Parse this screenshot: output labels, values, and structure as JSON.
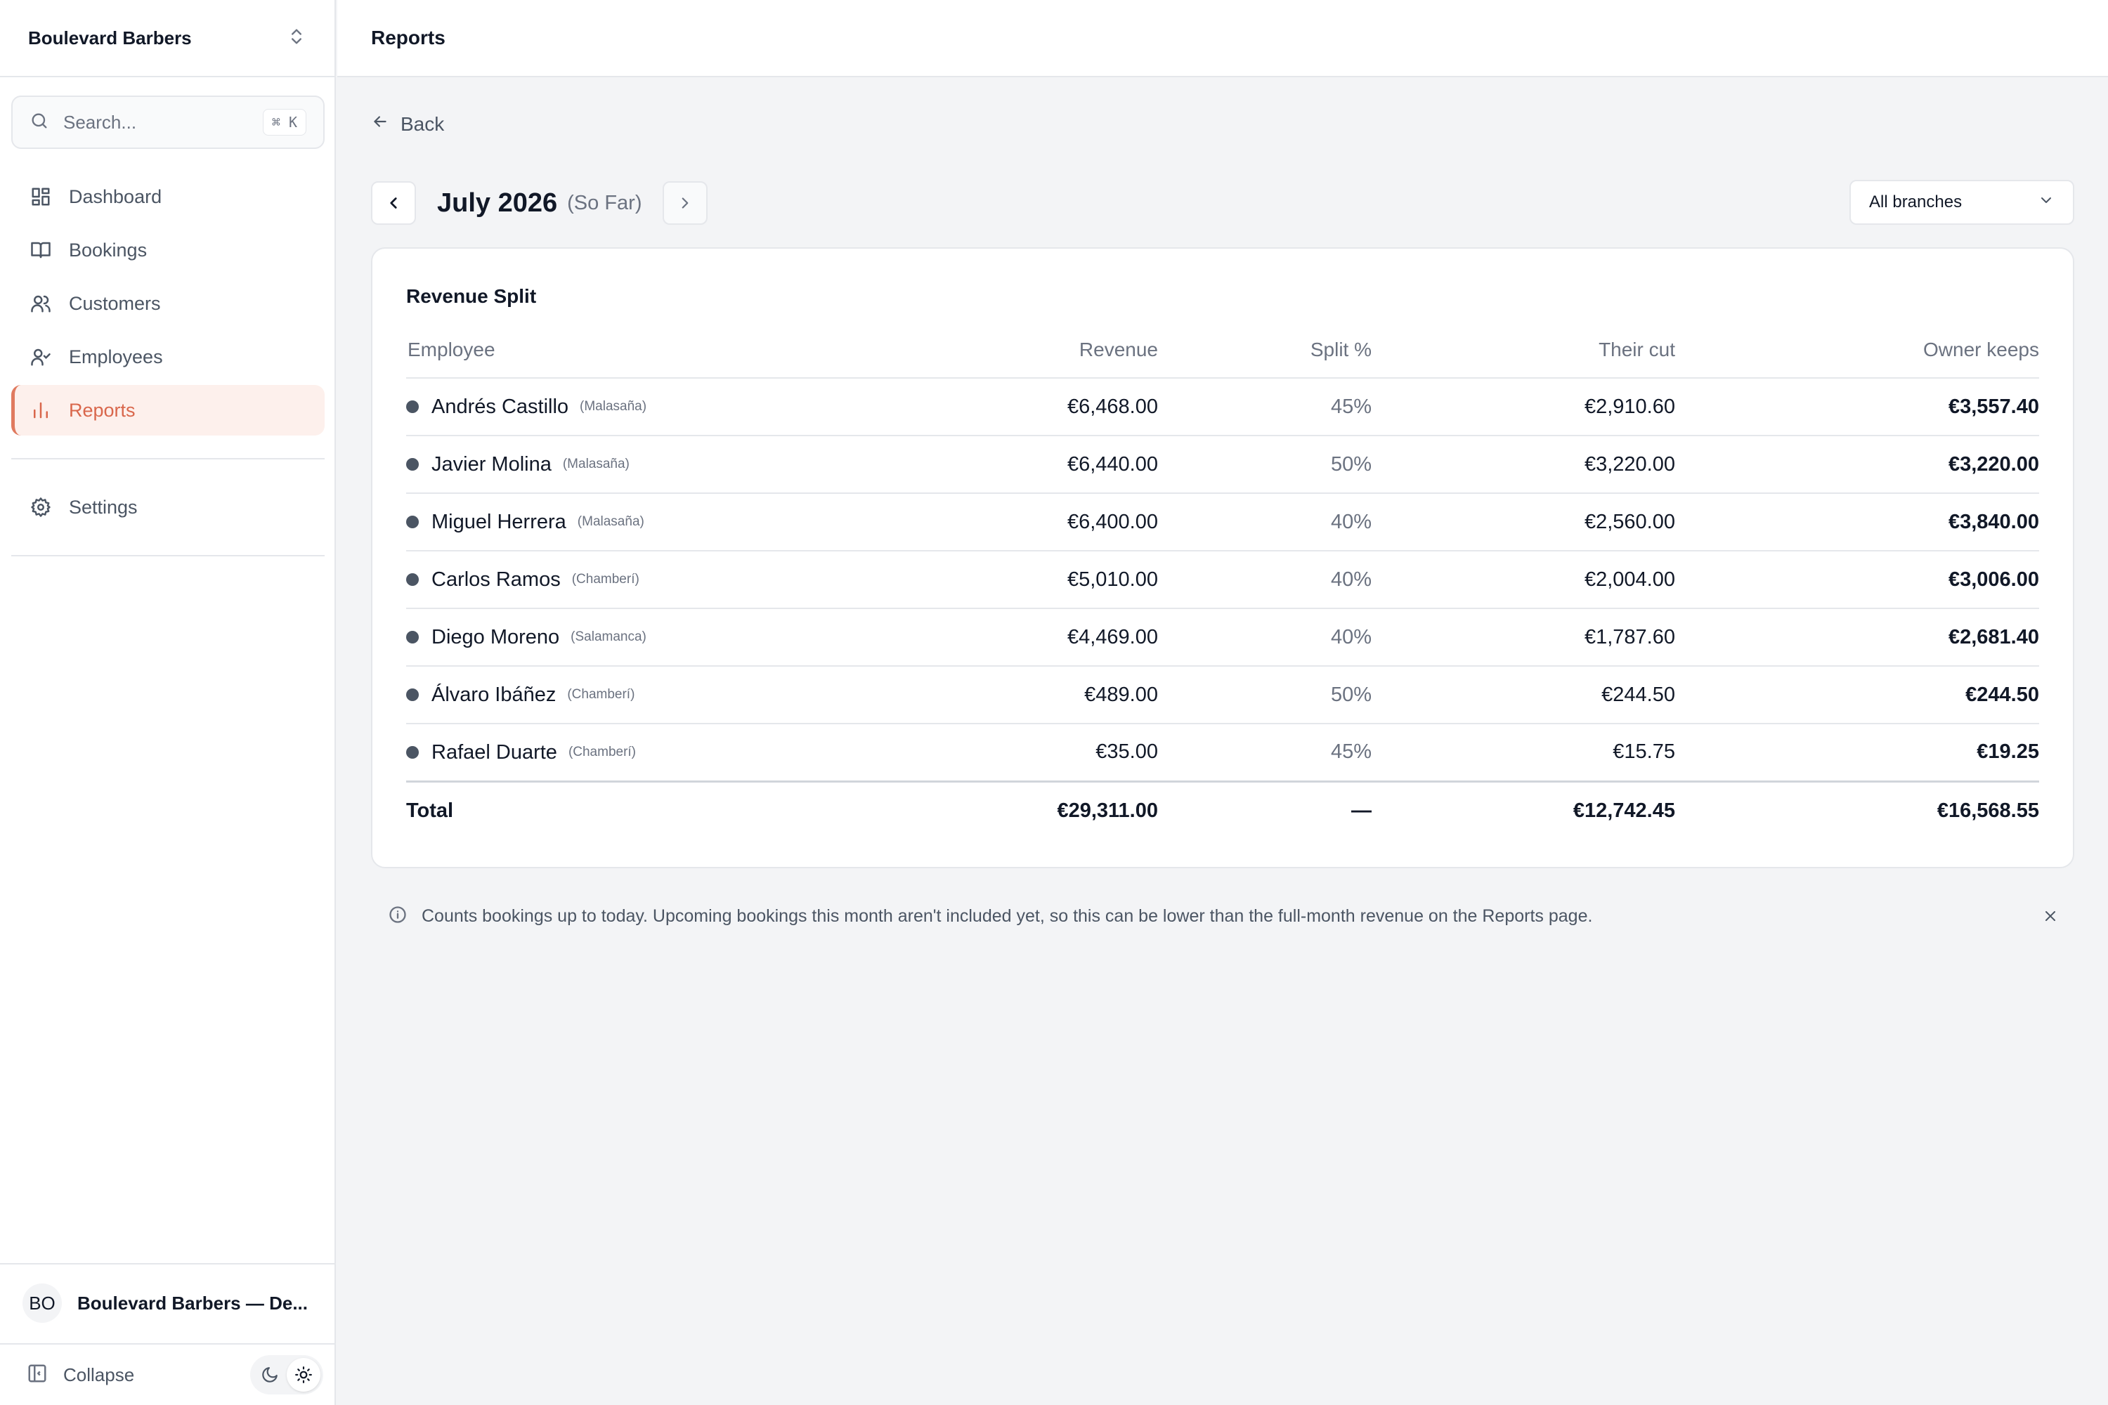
{
  "org": {
    "name": "Boulevard Barbers"
  },
  "search": {
    "placeholder": "Search...",
    "shortcut": "⌘ K"
  },
  "nav": {
    "items": [
      {
        "label": "Dashboard"
      },
      {
        "label": "Bookings"
      },
      {
        "label": "Customers"
      },
      {
        "label": "Employees"
      },
      {
        "label": "Reports"
      }
    ],
    "settings": "Settings"
  },
  "user": {
    "initials": "BO",
    "name": "Boulevard Barbers — De..."
  },
  "footer": {
    "collapse": "Collapse"
  },
  "header": {
    "title": "Reports"
  },
  "main": {
    "back": "Back",
    "month": "July 2026",
    "month_note": "(So Far)",
    "branch_filter": "All branches"
  },
  "report": {
    "title": "Revenue Split",
    "columns": {
      "employee": "Employee",
      "revenue": "Revenue",
      "split": "Split %",
      "cut": "Their cut",
      "keeps": "Owner keeps"
    },
    "rows": [
      {
        "name": "Andrés Castillo",
        "branch": "(Malasaña)",
        "revenue": "€6,468.00",
        "split": "45%",
        "cut": "€2,910.60",
        "keeps": "€3,557.40"
      },
      {
        "name": "Javier Molina",
        "branch": "(Malasaña)",
        "revenue": "€6,440.00",
        "split": "50%",
        "cut": "€3,220.00",
        "keeps": "€3,220.00"
      },
      {
        "name": "Miguel Herrera",
        "branch": "(Malasaña)",
        "revenue": "€6,400.00",
        "split": "40%",
        "cut": "€2,560.00",
        "keeps": "€3,840.00"
      },
      {
        "name": "Carlos Ramos",
        "branch": "(Chamberí)",
        "revenue": "€5,010.00",
        "split": "40%",
        "cut": "€2,004.00",
        "keeps": "€3,006.00"
      },
      {
        "name": "Diego Moreno",
        "branch": "(Salamanca)",
        "revenue": "€4,469.00",
        "split": "40%",
        "cut": "€1,787.60",
        "keeps": "€2,681.40"
      },
      {
        "name": "Álvaro Ibáñez",
        "branch": "(Chamberí)",
        "revenue": "€489.00",
        "split": "50%",
        "cut": "€244.50",
        "keeps": "€244.50"
      },
      {
        "name": "Rafael Duarte",
        "branch": "(Chamberí)",
        "revenue": "€35.00",
        "split": "45%",
        "cut": "€15.75",
        "keeps": "€19.25"
      }
    ],
    "total": {
      "label": "Total",
      "revenue": "€29,311.00",
      "split": "—",
      "cut": "€12,742.45",
      "keeps": "€16,568.55"
    }
  },
  "notice": "Counts bookings up to today. Upcoming bookings this month aren't included yet, so this can be lower than the full-month revenue on the Reports page.",
  "colors": {
    "accent": "#e07a5f",
    "accent_bg": "#fdf0ec"
  }
}
